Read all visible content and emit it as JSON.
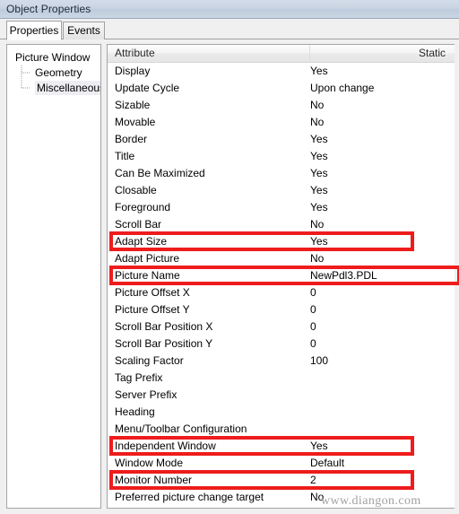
{
  "window": {
    "title": "Object Properties"
  },
  "tabs": [
    {
      "label": "Properties",
      "active": true
    },
    {
      "label": "Events",
      "active": false
    }
  ],
  "tree": {
    "root": {
      "label": "Picture Window"
    },
    "children": [
      {
        "label": "Geometry",
        "selected": false
      },
      {
        "label": "Miscellaneous",
        "selected": true
      }
    ]
  },
  "grid": {
    "columns": [
      "Attribute",
      "Static"
    ],
    "rows": [
      {
        "attribute": "Display",
        "static": "Yes"
      },
      {
        "attribute": "Update Cycle",
        "static": "Upon change"
      },
      {
        "attribute": "Sizable",
        "static": "No"
      },
      {
        "attribute": "Movable",
        "static": "No"
      },
      {
        "attribute": "Border",
        "static": "Yes"
      },
      {
        "attribute": "Title",
        "static": "Yes"
      },
      {
        "attribute": "Can Be Maximized",
        "static": "Yes"
      },
      {
        "attribute": "Closable",
        "static": "Yes"
      },
      {
        "attribute": "Foreground",
        "static": "Yes"
      },
      {
        "attribute": "Scroll Bar",
        "static": "No"
      },
      {
        "attribute": "Adapt Size",
        "static": "Yes"
      },
      {
        "attribute": "Adapt Picture",
        "static": "No"
      },
      {
        "attribute": "Picture Name",
        "static": "NewPdl3.PDL"
      },
      {
        "attribute": "Picture Offset X",
        "static": "0"
      },
      {
        "attribute": "Picture Offset Y",
        "static": "0"
      },
      {
        "attribute": "Scroll Bar Position X",
        "static": "0"
      },
      {
        "attribute": "Scroll Bar Position Y",
        "static": "0"
      },
      {
        "attribute": "Scaling Factor",
        "static": "100"
      },
      {
        "attribute": "Tag Prefix",
        "static": ""
      },
      {
        "attribute": "Server Prefix",
        "static": ""
      },
      {
        "attribute": "Heading",
        "static": ""
      },
      {
        "attribute": "Menu/Toolbar Configuration",
        "static": ""
      },
      {
        "attribute": "Independent Window",
        "static": "Yes"
      },
      {
        "attribute": "Window Mode",
        "static": "Default"
      },
      {
        "attribute": "Monitor Number",
        "static": "2"
      },
      {
        "attribute": "Preferred picture change target",
        "static": "No"
      }
    ]
  },
  "annotations": {
    "color": "#ee1c1c",
    "highlighted_rows": [
      "Adapt Size",
      "Picture Name",
      "Independent Window",
      "Monitor Number"
    ]
  },
  "watermark": {
    "text": "www.diangon.com"
  }
}
